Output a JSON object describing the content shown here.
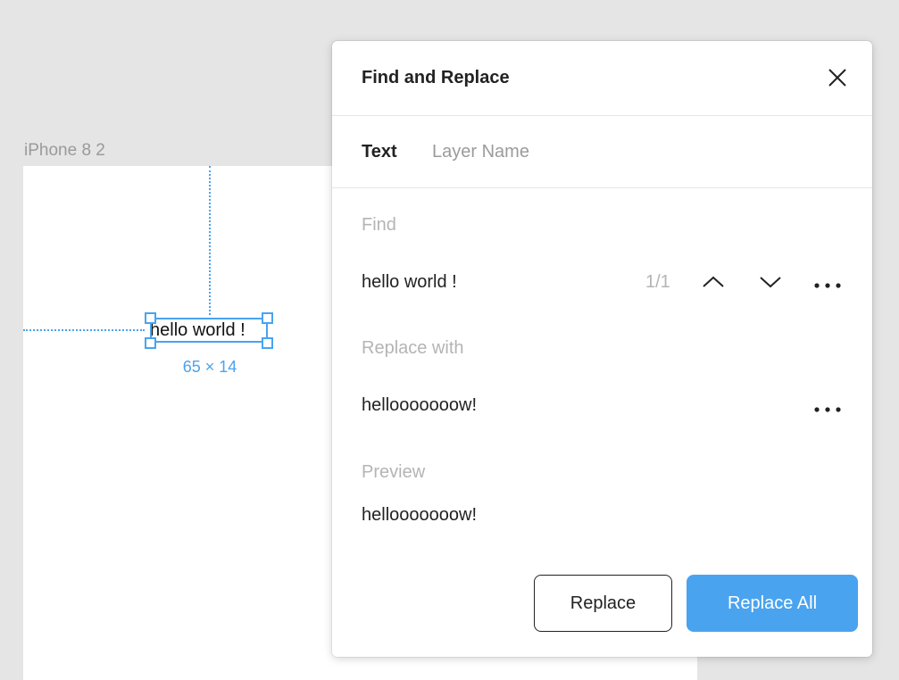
{
  "canvas": {
    "frame_label": "iPhone 8 2",
    "text_layer": "hello world !",
    "dimensions": "65 × 14"
  },
  "panel": {
    "title": "Find and Replace",
    "tabs": [
      {
        "label": "Text",
        "active": true
      },
      {
        "label": "Layer Name",
        "active": false
      }
    ],
    "find": {
      "label": "Find",
      "value": "hello world !",
      "counter": "1/1"
    },
    "replace": {
      "label": "Replace with",
      "value": "hellooooooow!"
    },
    "preview": {
      "label": "Preview",
      "value": "hellooooooow!"
    },
    "buttons": {
      "replace": "Replace",
      "replace_all": "Replace All"
    }
  },
  "colors": {
    "accent": "#4aa3ef",
    "canvas_bg": "#e5e5e5"
  }
}
